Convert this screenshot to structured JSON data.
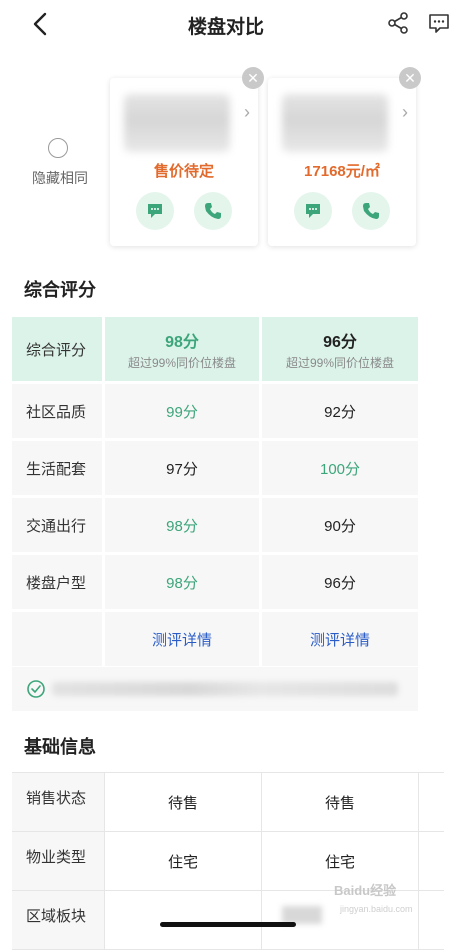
{
  "header": {
    "title": "楼盘对比",
    "back_icon": "chevron-left-icon",
    "share_icon": "share-icon",
    "message_icon": "chat-bubble-icon"
  },
  "compare": {
    "hide_same_label": "隐藏相同",
    "projects": [
      {
        "price": "售价待定",
        "price_color": "#e26a2c"
      },
      {
        "price": "17168元/㎡",
        "price_color": "#e26a2c"
      }
    ]
  },
  "score_section": {
    "title": "综合评分",
    "overall": {
      "label": "综合评分",
      "p1_score": "98分",
      "p1_sub": "超过99%同价位楼盘",
      "p2_score": "96分",
      "p2_sub": "超过99%同价位楼盘"
    },
    "rows": [
      {
        "label": "社区品质",
        "p1": "99分",
        "p2": "92分"
      },
      {
        "label": "生活配套",
        "p1": "97分",
        "p2": "100分"
      },
      {
        "label": "交通出行",
        "p1": "98分",
        "p2": "90分"
      },
      {
        "label": "楼盘户型",
        "p1": "98分",
        "p2": "96分"
      }
    ],
    "detail_link": "测评详情",
    "highlight_color": "#3da57a",
    "link_color": "#2a5cc8"
  },
  "basic_section": {
    "title": "基础信息",
    "rows": [
      {
        "label": "销售状态",
        "p1": "待售",
        "p2": "待售"
      },
      {
        "label": "物业类型",
        "p1": "住宅",
        "p2": "住宅"
      },
      {
        "label": "区域板块",
        "p1": "",
        "p2": ""
      }
    ]
  },
  "watermark": {
    "text": "Baidu经验",
    "sub": "jingyan.baidu.com"
  }
}
